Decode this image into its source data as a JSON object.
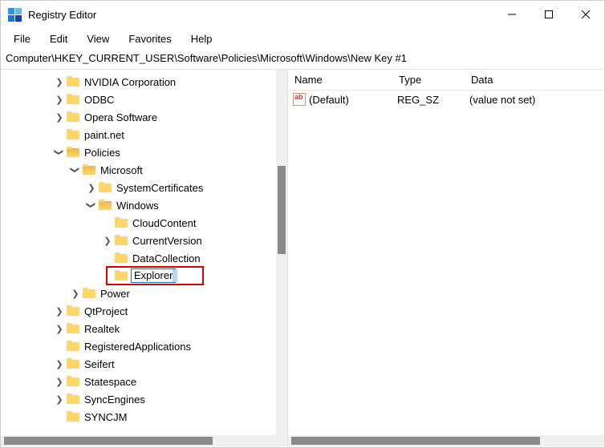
{
  "window": {
    "title": "Registry Editor"
  },
  "menu": {
    "file": "File",
    "edit": "Edit",
    "view": "View",
    "favorites": "Favorites",
    "help": "Help"
  },
  "address": "Computer\\HKEY_CURRENT_USER\\Software\\Policies\\Microsoft\\Windows\\New Key #1",
  "tree": {
    "nvidia": "NVIDIA Corporation",
    "odbc": "ODBC",
    "opera": "Opera Software",
    "paintnet": "paint.net",
    "policies": "Policies",
    "microsoft": "Microsoft",
    "systemcerts": "SystemCertificates",
    "windows": "Windows",
    "cloudcontent": "CloudContent",
    "currentversion": "CurrentVersion",
    "datacollection": "DataCollection",
    "explorer": "Explorer",
    "power": "Power",
    "qtproject": "QtProject",
    "realtek": "Realtek",
    "regapps": "RegisteredApplications",
    "seifert": "Seifert",
    "statespace": "Statespace",
    "syncengines": "SyncEngines",
    "syncjm": "SYNCJM"
  },
  "list": {
    "header": {
      "name": "Name",
      "type": "Type",
      "data": "Data"
    },
    "rows": [
      {
        "name": "(Default)",
        "type": "REG_SZ",
        "data": "(value not set)"
      }
    ]
  }
}
